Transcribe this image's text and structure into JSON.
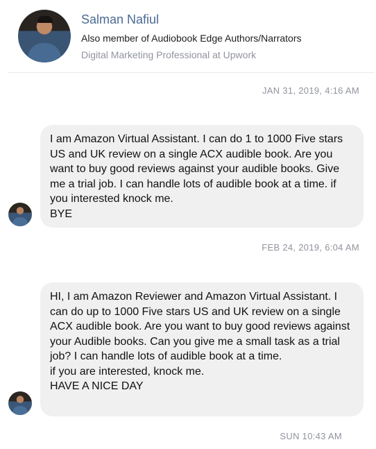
{
  "profile": {
    "name": "Salman Nafiul",
    "membership": "Also member of Audiobook Edge Authors/Narrators",
    "job": "Digital Marketing Professional at Upwork"
  },
  "messages": [
    {
      "timestamp": "JAN 31, 2019, 4:16 AM",
      "text": "I am Amazon Virtual Assistant. I can do 1 to 1000 Five stars US and UK review on a single ACX audible book. Are you want to buy good reviews against your audible books. Give me a trial job. I can handle lots of audible book at a time. if you interested knock me.\nBYE"
    },
    {
      "timestamp": "FEB 24, 2019, 6:04 AM",
      "text": "HI, I am Amazon Reviewer and Amazon Virtual Assistant. I can do up to 1000 Five stars US and UK review on a single ACX audible book. Are you want to buy good reviews against your Audible books. Can you give me a small task as a trial job? I can handle lots of audible book at a time.\nif you are interested, knock me.\nHAVE A NICE DAY"
    }
  ],
  "footer_timestamp": "SUN 10:43 AM"
}
